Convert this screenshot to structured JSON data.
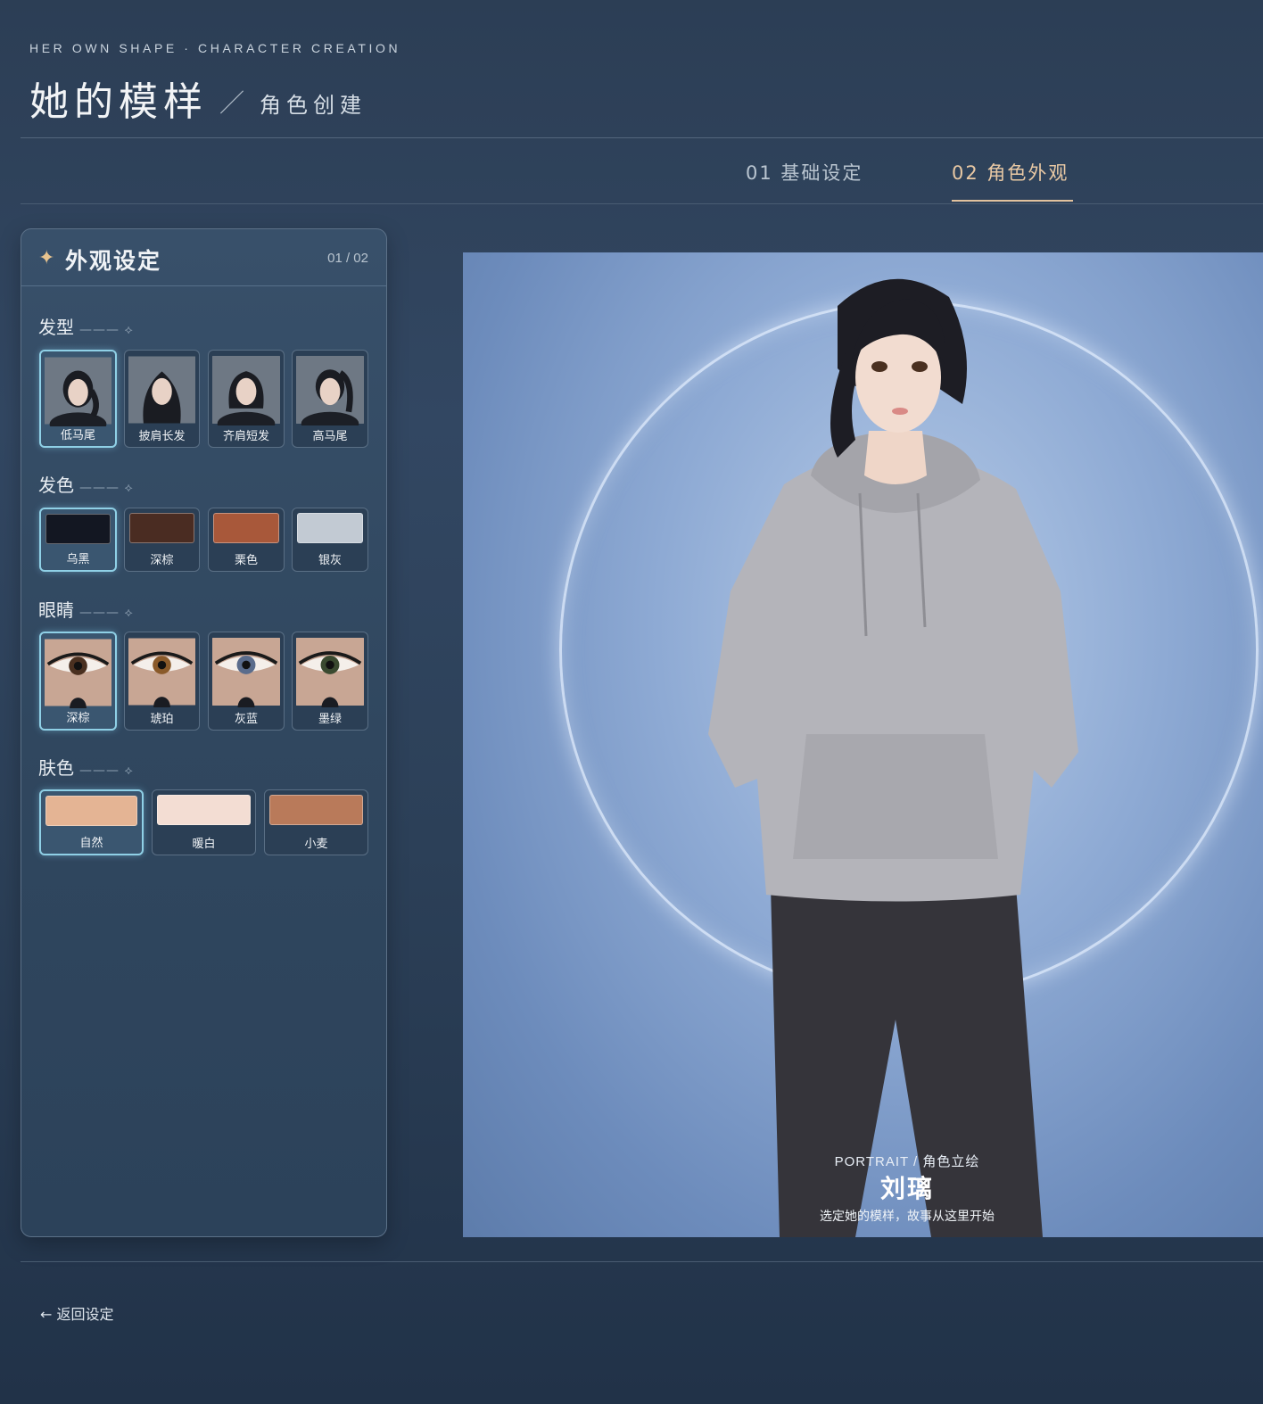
{
  "header": {
    "eyebrow": "HER OWN SHAPE · CHARACTER CREATION",
    "title": "她的模样",
    "slash": "／",
    "subtitle": "角色创建"
  },
  "tabs": [
    {
      "label": "01  基础设定",
      "active": false
    },
    {
      "label": "02  角色外观",
      "active": true
    }
  ],
  "panel": {
    "title": "外观设定",
    "page": "01 / 02",
    "sections": {
      "hair_style": {
        "title": "发型",
        "decor": "——— ⟡",
        "options": [
          "低马尾",
          "披肩长发",
          "齐肩短发",
          "高马尾"
        ],
        "selected": "低马尾"
      },
      "hair_color": {
        "title": "发色",
        "decor": "——— ⟡",
        "options": [
          {
            "label": "乌黑",
            "color": "#131722"
          },
          {
            "label": "深棕",
            "color": "#4a2c22"
          },
          {
            "label": "栗色",
            "color": "#a8583a"
          },
          {
            "label": "银灰",
            "color": "#c2cad3"
          }
        ],
        "selected": "乌黑"
      },
      "eyes": {
        "title": "眼睛",
        "decor": "——— ⟡",
        "options": [
          {
            "label": "深棕",
            "iris": "#4a3020"
          },
          {
            "label": "琥珀",
            "iris": "#8a5a2a"
          },
          {
            "label": "灰蓝",
            "iris": "#5a6c8c"
          },
          {
            "label": "墨绿",
            "iris": "#3a4a30"
          }
        ],
        "selected": "深棕"
      },
      "skin": {
        "title": "肤色",
        "decor": "——— ⟡",
        "options": [
          {
            "label": "自然",
            "color": "#e4b494"
          },
          {
            "label": "暖白",
            "color": "#f3ddd3"
          },
          {
            "label": "小麦",
            "color": "#b97a5a"
          }
        ],
        "selected": "自然"
      }
    }
  },
  "portrait": {
    "eyebrow": "PORTRAIT / 角色立绘",
    "name": "刘璃",
    "tagline": "选定她的模样，故事从这里开始"
  },
  "footer": {
    "back_label": "← 返回设定"
  },
  "colors": {
    "accent": "#e2c29e",
    "selected_border": "#8fd0e6"
  }
}
